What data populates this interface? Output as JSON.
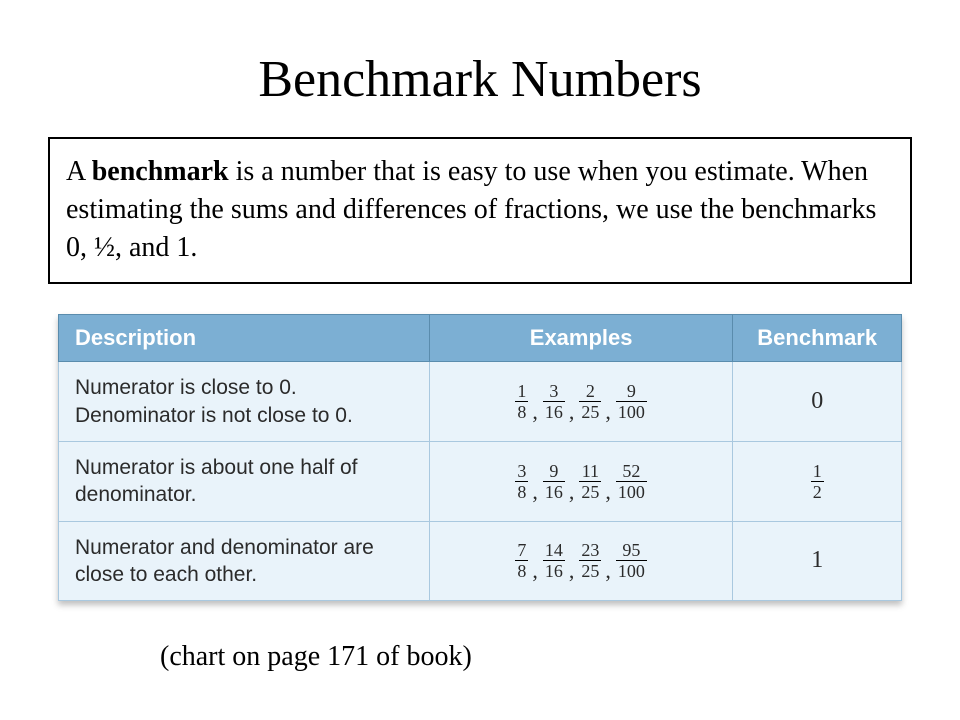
{
  "title": "Benchmark Numbers",
  "definition": {
    "lead_word": "benchmark",
    "prefix": "A ",
    "text_after": " is a number that is easy to use when you estimate. When estimating the sums and differences of fractions, we use the benchmarks 0, ½, and 1."
  },
  "table": {
    "headers": {
      "description": "Description",
      "examples": "Examples",
      "benchmark": "Benchmark"
    },
    "rows": [
      {
        "description": "Numerator is close to 0. Denominator is not close to 0.",
        "fractions": [
          {
            "num": "1",
            "den": "8"
          },
          {
            "num": "3",
            "den": "16"
          },
          {
            "num": "2",
            "den": "25"
          },
          {
            "num": "9",
            "den": "100"
          }
        ],
        "benchmark_text": "0",
        "benchmark_frac": null
      },
      {
        "description": "Numerator is about one half of denominator.",
        "fractions": [
          {
            "num": "3",
            "den": "8"
          },
          {
            "num": "9",
            "den": "16"
          },
          {
            "num": "11",
            "den": "25"
          },
          {
            "num": "52",
            "den": "100"
          }
        ],
        "benchmark_text": null,
        "benchmark_frac": {
          "num": "1",
          "den": "2"
        }
      },
      {
        "description": "Numerator and denominator are close to each other.",
        "fractions": [
          {
            "num": "7",
            "den": "8"
          },
          {
            "num": "14",
            "den": "16"
          },
          {
            "num": "23",
            "den": "25"
          },
          {
            "num": "95",
            "den": "100"
          }
        ],
        "benchmark_text": "1",
        "benchmark_frac": null
      }
    ]
  },
  "caption": "(chart on page 171 of book)"
}
